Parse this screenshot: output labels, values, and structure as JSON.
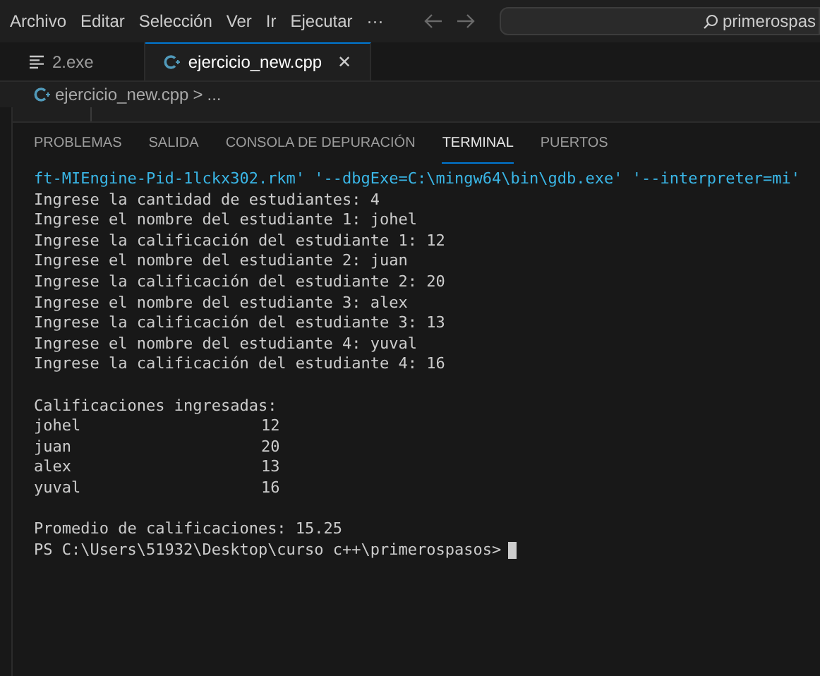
{
  "menu": [
    "Archivo",
    "Editar",
    "Selección",
    "Ver",
    "Ir",
    "Ejecutar",
    "···"
  ],
  "search": {
    "value": "primerospas"
  },
  "editor_tabs": [
    {
      "label": "2.exe",
      "kind": "text",
      "selected": false
    },
    {
      "label": "ejercicio_new.cpp",
      "kind": "cpp",
      "selected": true
    }
  ],
  "close_glyph": "✕",
  "breadcrumb": {
    "file": "ejercicio_new.cpp",
    "separator": ">",
    "rest": "..."
  },
  "panel_tabs": [
    {
      "label": "PROBLEMAS",
      "selected": false
    },
    {
      "label": "SALIDA",
      "selected": false
    },
    {
      "label": "CONSOLA DE DEPURACIÓN",
      "selected": false
    },
    {
      "label": "TERMINAL",
      "selected": true
    },
    {
      "label": "PUERTOS",
      "selected": false
    }
  ],
  "terminal": [
    {
      "kind": "command",
      "text": "ft-MIEngine-Pid-1lckx302.rkm' '--dbgExe=C:\\mingw64\\bin\\gdb.exe' '--interpreter=mi'"
    },
    {
      "kind": "text",
      "text": "Ingrese la cantidad de estudiantes: 4"
    },
    {
      "kind": "text",
      "text": "Ingrese el nombre del estudiante 1: johel"
    },
    {
      "kind": "text",
      "text": "Ingrese la calificación del estudiante 1: 12"
    },
    {
      "kind": "text",
      "text": "Ingrese el nombre del estudiante 2: juan"
    },
    {
      "kind": "text",
      "text": "Ingrese la calificación del estudiante 2: 20"
    },
    {
      "kind": "text",
      "text": "Ingrese el nombre del estudiante 3: alex"
    },
    {
      "kind": "text",
      "text": "Ingrese la calificación del estudiante 3: 13"
    },
    {
      "kind": "text",
      "text": "Ingrese el nombre del estudiante 4: yuval"
    },
    {
      "kind": "text",
      "text": "Ingrese la calificación del estudiante 4: 16"
    },
    {
      "kind": "gap"
    },
    {
      "kind": "text",
      "text": "Calificaciones ingresadas:"
    },
    {
      "kind": "row",
      "name": "johel",
      "grade": "12"
    },
    {
      "kind": "row",
      "name": "juan",
      "grade": "20"
    },
    {
      "kind": "row",
      "name": "alex",
      "grade": "13"
    },
    {
      "kind": "row",
      "name": "yuval",
      "grade": "16"
    },
    {
      "kind": "gap"
    },
    {
      "kind": "text",
      "text": "Promedio de calificaciones: 15.25"
    },
    {
      "kind": "prompt",
      "text": "PS C:\\Users\\51932\\Desktop\\curso c++\\primerospasos>"
    }
  ]
}
